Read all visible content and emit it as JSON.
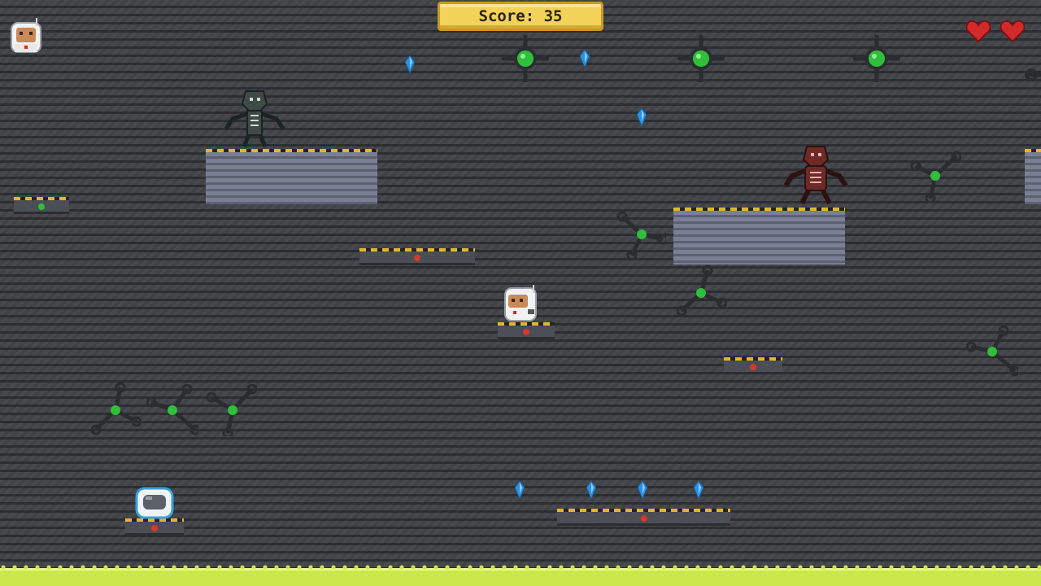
{
  "hud": {
    "score_text": "Score: 35",
    "lives": 2,
    "life_icon": "heart-icon",
    "player_avatar_icon": "astronaut-icon"
  },
  "colors": {
    "score_banner": "#f3d25a",
    "heart": "#d12a2a",
    "crystal": "#2f8fdd",
    "acid": "#cbe84a",
    "hazard_stripe": "#e3b62a",
    "light_red": "#d23a2a",
    "light_green": "#2fbf3a"
  },
  "entities": {
    "player": "astronaut-icon",
    "enemy_skeleton": "skeleton-robot-icon",
    "enemy_red_robot": "red-robot-icon",
    "helmet_pickup": "helmet-icon",
    "crystal": "blue-crystal-icon",
    "drone": "green-core-drone-icon",
    "mine": "tripod-mine-icon"
  }
}
